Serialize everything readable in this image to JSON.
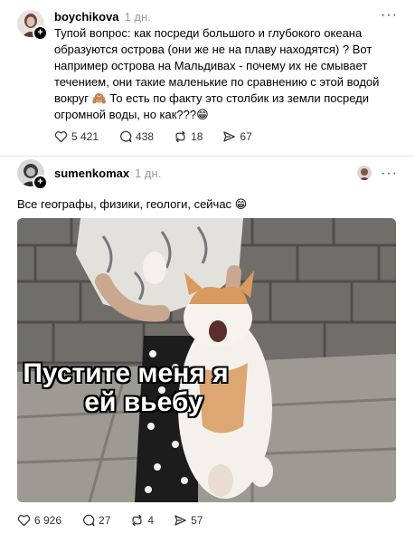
{
  "post1": {
    "username": "boychikova",
    "time": "1 дн.",
    "text": "Тупой вопрос: как посреди большого и глубокого океана образуются острова (они же не на плаву находятся) ? Вот например острова на Мальдивах - почему их не смывает течением, они такие маленькие по сравнению с этой водой вокруг 🙈  То есть по факту это столбик из земли посреди огромной воды, но как???😁",
    "likes": "5 421",
    "comments": "438",
    "reposts": "18",
    "shares": "67"
  },
  "post2": {
    "username": "sumenkomax",
    "time": "1 дн.",
    "text": "Все географы, физики, геологи, сейчас 😁",
    "meme_caption_line1": "Пустите меня я",
    "meme_caption_line2": "ей вьебу",
    "likes": "6 926",
    "comments": "27",
    "reposts": "4",
    "shares": "57"
  },
  "colors": {
    "text": "#000000",
    "secondary": "#999999",
    "divider": "#e5e5e5"
  },
  "icons": [
    "more-icon",
    "plus-icon",
    "heart-icon",
    "comment-icon",
    "repost-icon",
    "share-icon"
  ]
}
